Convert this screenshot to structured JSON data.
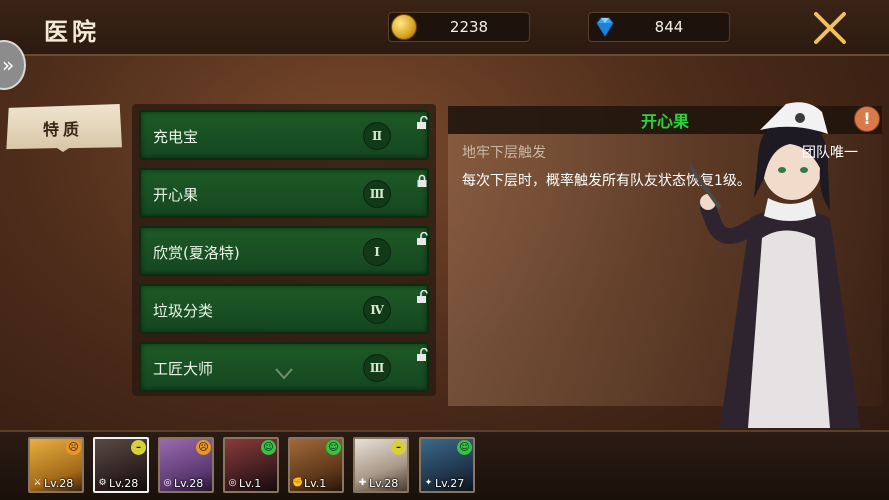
{
  "header": {
    "title": "医院"
  },
  "resources": {
    "gold": "2238",
    "gems": "844"
  },
  "tabs": [
    {
      "label": "特质"
    }
  ],
  "traits": [
    {
      "name": "充电宝",
      "level": "Ⅱ"
    },
    {
      "name": "开心果",
      "level": "Ⅲ"
    },
    {
      "name": "欣赏(夏洛特)",
      "level": "Ⅰ"
    },
    {
      "name": "垃圾分类",
      "level": "Ⅳ"
    },
    {
      "name": "工匠大师",
      "level": "Ⅲ"
    }
  ],
  "detail": {
    "title": "开心果",
    "trigger": "地牢下层触发",
    "scope": "团队唯一",
    "description": "每次下层时，概率触发所有队友状态恢复1级。"
  },
  "roster": [
    {
      "level": "Lv.28",
      "mood": "orange",
      "class_icon": "sword-icon"
    },
    {
      "level": "Lv.28",
      "mood": "yellow",
      "class_icon": "gear-icon"
    },
    {
      "level": "Lv.28",
      "mood": "orange",
      "class_icon": "target-icon"
    },
    {
      "level": "Lv.1",
      "mood": "green",
      "class_icon": "target-icon"
    },
    {
      "level": "Lv.1",
      "mood": "green",
      "class_icon": "fist-icon"
    },
    {
      "level": "Lv.28",
      "mood": "yellow",
      "class_icon": "staff-icon"
    },
    {
      "level": "Lv.27",
      "mood": "green",
      "class_icon": "wand-icon"
    }
  ],
  "colors": {
    "accent_green": "#26d63a",
    "trait_bg": "#1e5a26",
    "mood_orange": "#e8962a",
    "mood_yellow": "#d8d03a",
    "mood_green": "#34c444"
  }
}
